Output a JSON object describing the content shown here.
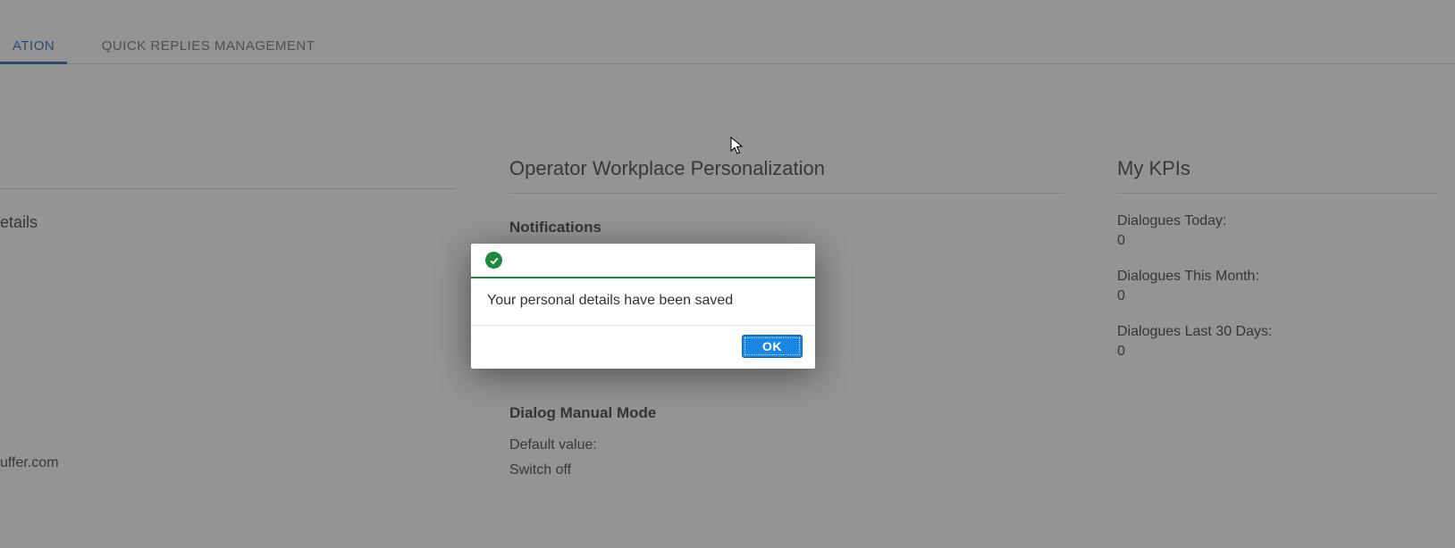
{
  "tabs": {
    "active_fragment": "ATION",
    "second": "QUICK REPLIES MANAGEMENT"
  },
  "col1": {
    "heading_fragment": "etails",
    "email_fragment": "uffer.com"
  },
  "col2": {
    "title": "Operator Workplace Personalization",
    "notifications_heading": "Notifications",
    "dialog_mode_heading": "Dialog Manual Mode",
    "default_label": "Default value:",
    "default_value": "Switch off"
  },
  "col3": {
    "title": "My KPIs",
    "kpis": [
      {
        "label": "Dialogues Today:",
        "value": "0"
      },
      {
        "label": "Dialogues This Month:",
        "value": "0"
      },
      {
        "label": "Dialogues Last 30 Days:",
        "value": "0"
      }
    ]
  },
  "modal": {
    "message": "Your personal details have been saved",
    "ok": "OK"
  }
}
